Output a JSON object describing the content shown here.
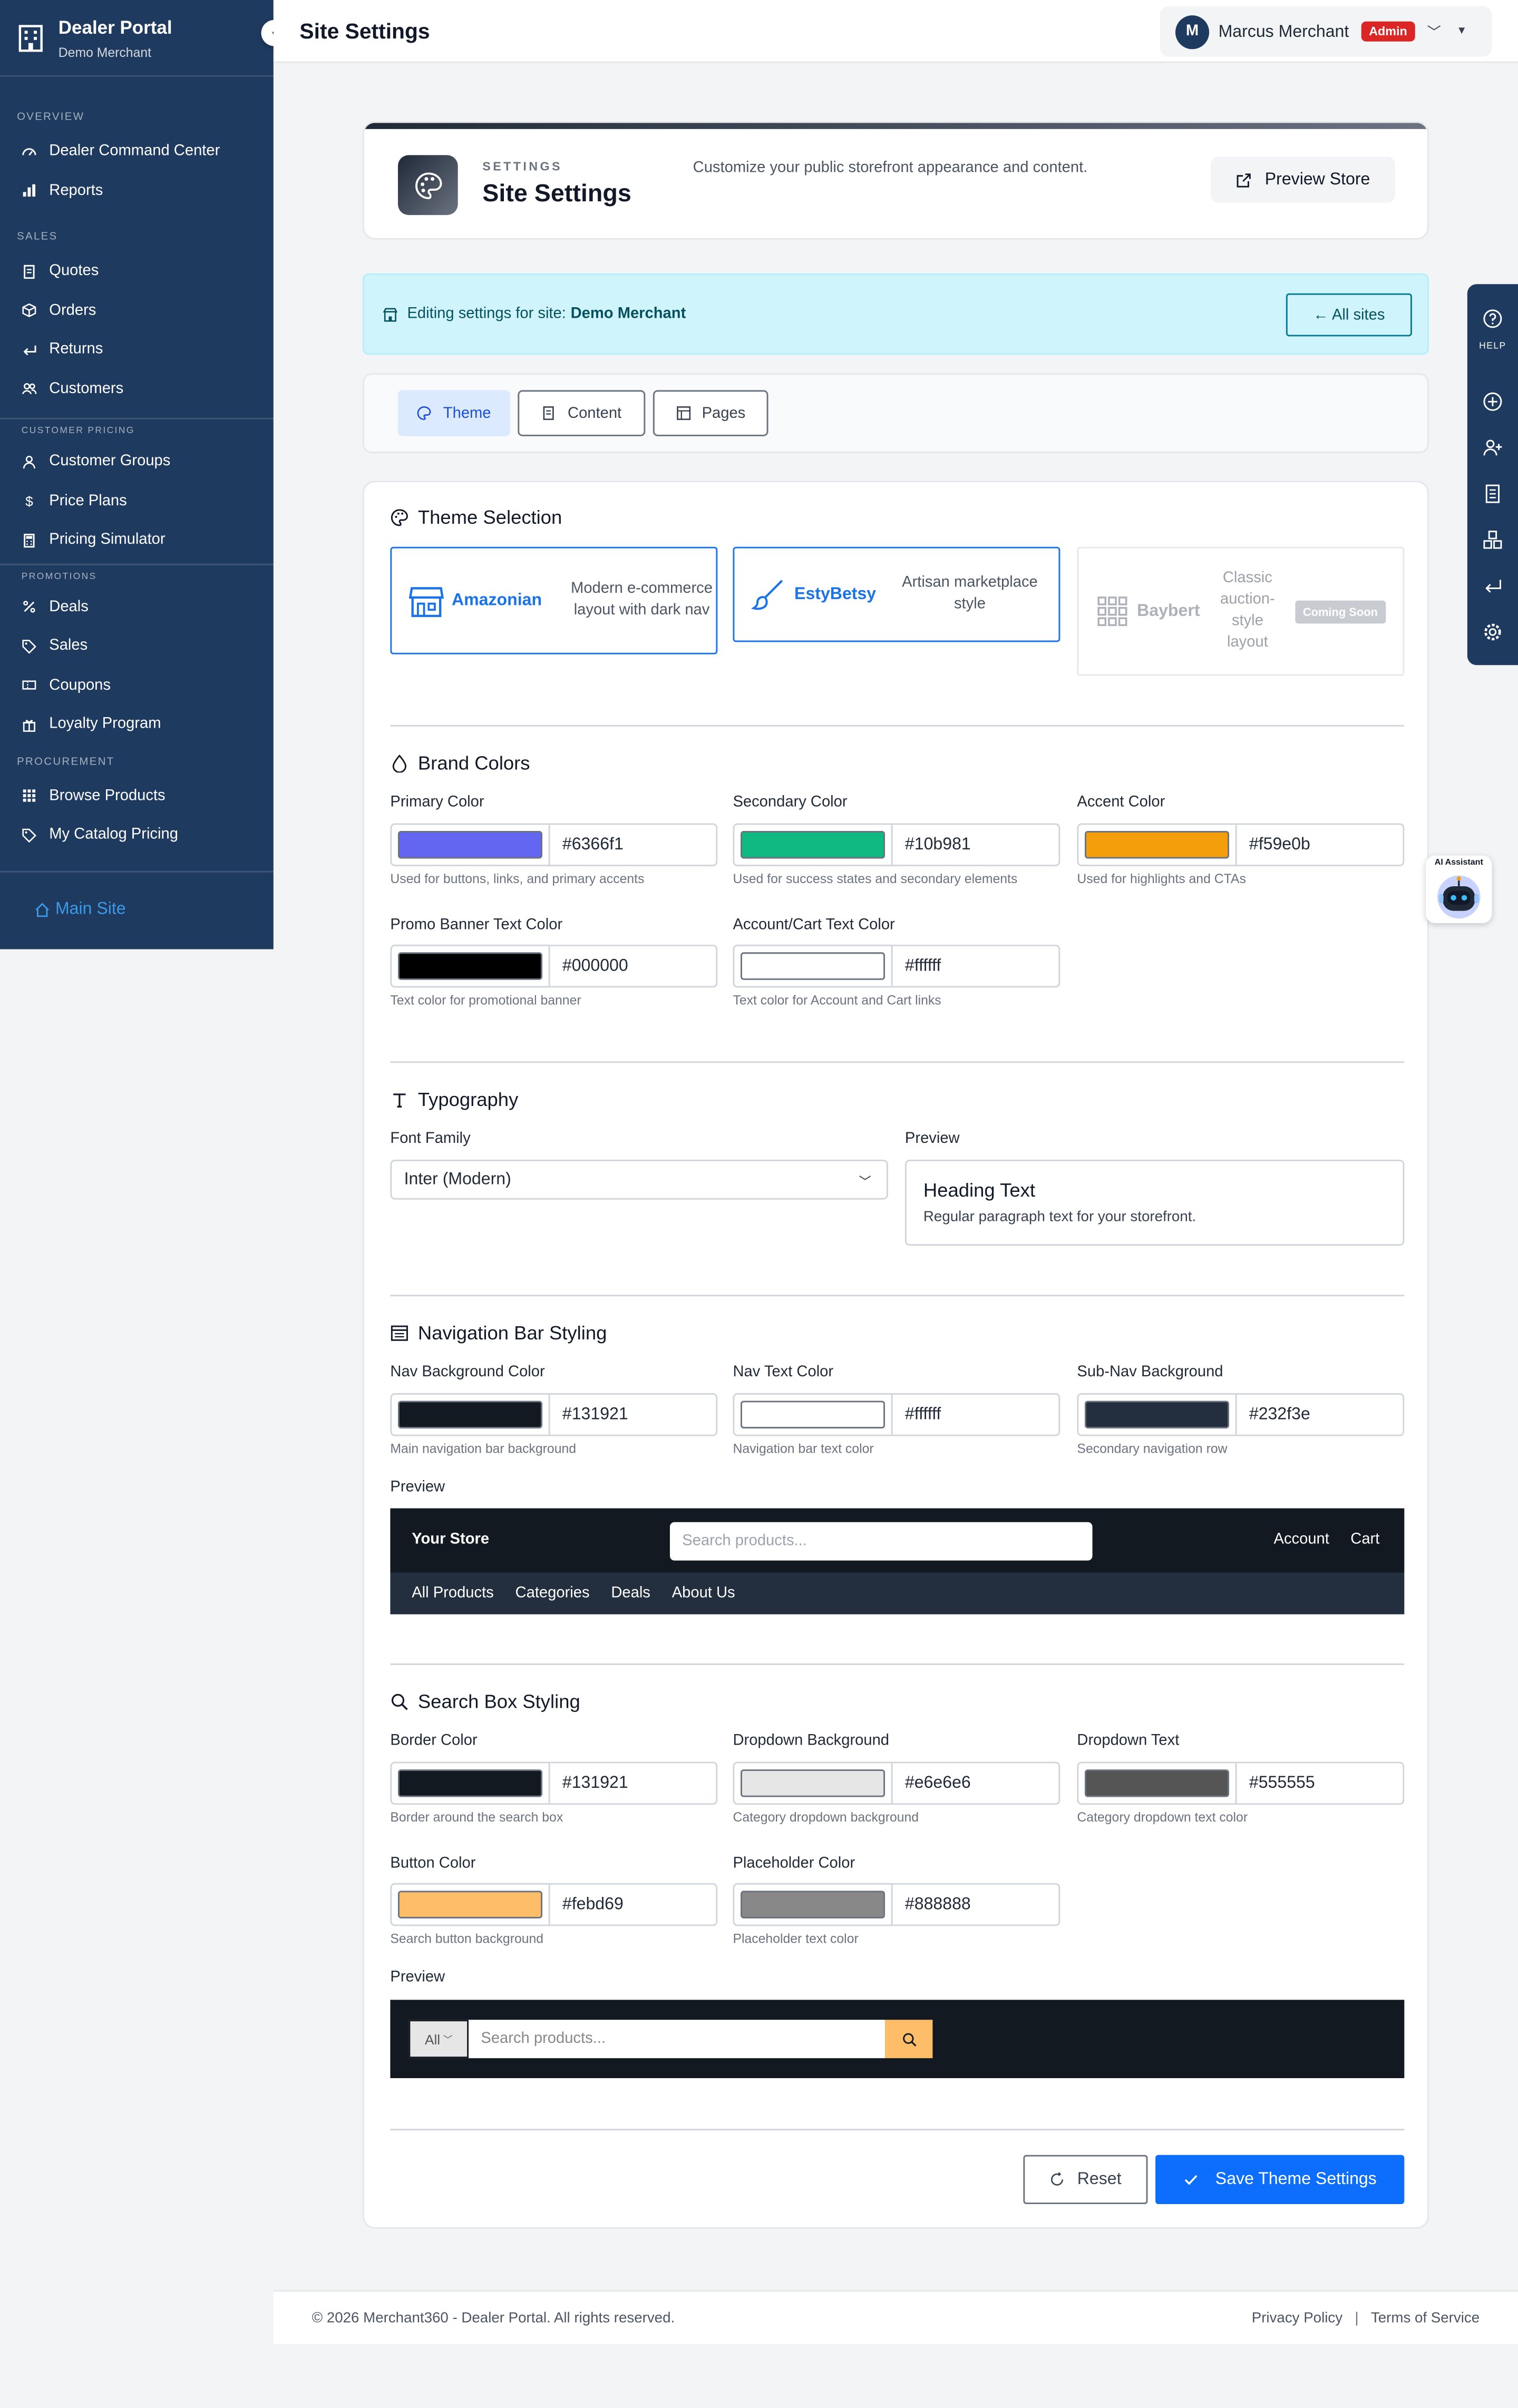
{
  "sidebar": {
    "title": "Dealer Portal",
    "subtitle": "Demo Merchant",
    "sections": [
      {
        "label": "OVERVIEW",
        "items": [
          "Dealer Command Center",
          "Reports"
        ]
      },
      {
        "label": "SALES",
        "items": [
          "Quotes",
          "Orders",
          "Returns",
          "Customers"
        ]
      },
      {
        "label": "CUSTOMER PRICING",
        "items": [
          "Customer Groups",
          "Price Plans",
          "Pricing Simulator"
        ]
      },
      {
        "label": "PROMOTIONS",
        "items": [
          "Deals",
          "Sales",
          "Coupons",
          "Loyalty Program"
        ]
      },
      {
        "label": "PROCUREMENT",
        "items": [
          "Browse Products",
          "My Catalog Pricing"
        ]
      }
    ],
    "main_site": "Main Site"
  },
  "topbar": {
    "page_title": "Site Settings",
    "user_initial": "M",
    "user_name": "Marcus Merchant",
    "role_badge": "Admin"
  },
  "header": {
    "kicker": "SETTINGS",
    "title": "Site Settings",
    "description": "Customize your public storefront appearance and content.",
    "preview_button": "Preview Store"
  },
  "info": {
    "prefix": "Editing settings for site:",
    "site": "Demo Merchant",
    "all_sites_button": "← All sites"
  },
  "tabs": [
    {
      "label": "Theme",
      "active": true,
      "icon": "palette-icon"
    },
    {
      "label": "Content",
      "active": false,
      "icon": "document-icon"
    },
    {
      "label": "Pages",
      "active": false,
      "icon": "pages-icon"
    }
  ],
  "theme_selection": {
    "title": "Theme Selection",
    "options": [
      {
        "name": "Amazonian",
        "desc": "Modern e-commerce layout with dark nav",
        "icon": "storefront-icon"
      },
      {
        "name": "EstyBetsy",
        "desc": "Artisan marketplace style",
        "icon": "brush-icon"
      },
      {
        "name": "Baybert",
        "desc": "Classic auction-style layout",
        "badge": "Coming Soon",
        "icon": "grid-icon"
      }
    ]
  },
  "brand_colors": {
    "title": "Brand Colors",
    "fields": [
      {
        "label": "Primary Color",
        "value": "#6366f1",
        "hint": "Used for buttons, links, and primary accents"
      },
      {
        "label": "Secondary Color",
        "value": "#10b981",
        "hint": "Used for success states and secondary elements"
      },
      {
        "label": "Accent Color",
        "value": "#f59e0b",
        "hint": "Used for highlights and CTAs"
      },
      {
        "label": "Promo Banner Text Color",
        "value": "#000000",
        "hint": "Text color for promotional banner"
      },
      {
        "label": "Account/Cart Text Color",
        "value": "#ffffff",
        "hint": "Text color for Account and Cart links"
      }
    ]
  },
  "typography": {
    "title": "Typography",
    "font_label": "Font Family",
    "font_value": "Inter (Modern)",
    "preview_label": "Preview",
    "preview_heading": "Heading Text",
    "preview_paragraph": "Regular paragraph text for your storefront."
  },
  "nav_styling": {
    "title": "Navigation Bar Styling",
    "fields": [
      {
        "label": "Nav Background Color",
        "value": "#131921",
        "hint": "Main navigation bar background"
      },
      {
        "label": "Nav Text Color",
        "value": "#ffffff",
        "hint": "Navigation bar text color"
      },
      {
        "label": "Sub-Nav Background",
        "value": "#232f3e",
        "hint": "Secondary navigation row"
      }
    ],
    "preview_label": "Preview",
    "preview": {
      "store": "Your Store",
      "search_placeholder": "Search products...",
      "account": "Account",
      "cart": "Cart",
      "sub_links": [
        "All Products",
        "Categories",
        "Deals",
        "About Us"
      ]
    }
  },
  "search_styling": {
    "title": "Search Box Styling",
    "fields": [
      {
        "label": "Border Color",
        "value": "#131921",
        "hint": "Border around the search box"
      },
      {
        "label": "Dropdown Background",
        "value": "#e6e6e6",
        "hint": "Category dropdown background"
      },
      {
        "label": "Dropdown Text",
        "value": "#555555",
        "hint": "Category dropdown text color"
      },
      {
        "label": "Button Color",
        "value": "#febd69",
        "hint": "Search button background"
      },
      {
        "label": "Placeholder Color",
        "value": "#888888",
        "hint": "Placeholder text color"
      }
    ],
    "preview_label": "Preview",
    "preview": {
      "dropdown": "All",
      "placeholder": "Search products..."
    }
  },
  "actions": {
    "reset": "Reset",
    "save": "Save Theme Settings"
  },
  "footer": {
    "copyright": "© 2026 Merchant360 - Dealer Portal. All rights reserved.",
    "privacy": "Privacy Policy",
    "separator": "|",
    "terms": "Terms of Service"
  },
  "rail": {
    "help_label": "HELP"
  },
  "ai_widget": {
    "label": "AI Assistant"
  }
}
